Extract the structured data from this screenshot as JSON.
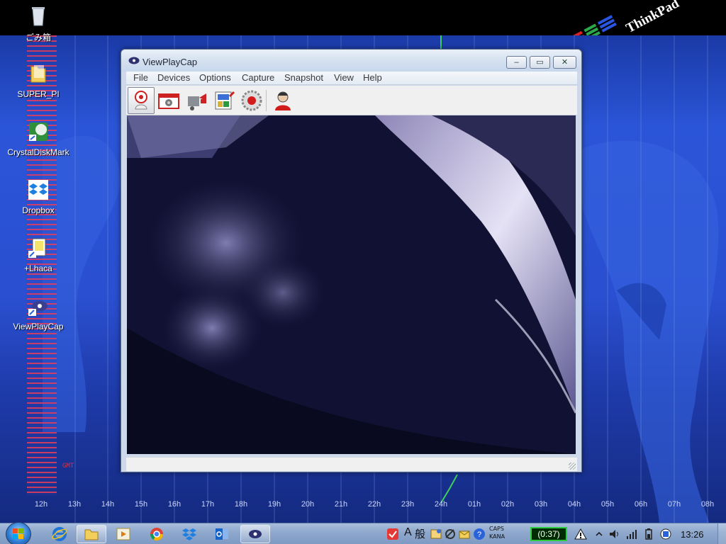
{
  "desktop": {
    "icons": [
      {
        "label": "ごみ箱",
        "icon": "recycle-bin-icon"
      },
      {
        "label": "SUPER_PI",
        "icon": "folder-icon"
      },
      {
        "label": "CrystalDiskMark",
        "icon": "crystaldiskmark-icon"
      },
      {
        "label": "Dropbox",
        "icon": "dropbox-icon"
      },
      {
        "label": "+Lhaca",
        "icon": "lhaca-icon"
      },
      {
        "label": "ViewPlayCap",
        "icon": "viewplaycap-icon"
      }
    ],
    "wallpaper": {
      "brand": "ThinkPad",
      "gmt_label": "GMT",
      "hours": [
        "12h",
        "13h",
        "14h",
        "15h",
        "16h",
        "17h",
        "18h",
        "19h",
        "20h",
        "21h",
        "22h",
        "23h",
        "24h",
        "01h",
        "02h",
        "03h",
        "04h",
        "05h",
        "06h",
        "07h",
        "08h"
      ]
    }
  },
  "window": {
    "title": "ViewPlayCap",
    "controls": {
      "minimize": "‒",
      "maximize": "▭",
      "close": "✕"
    },
    "menu": [
      "File",
      "Devices",
      "Options",
      "Capture",
      "Snapshot",
      "View",
      "Help"
    ],
    "toolbar": [
      {
        "icon": "webcam-preview-icon",
        "active": true
      },
      {
        "icon": "camera-snapshot-icon",
        "active": false
      },
      {
        "icon": "video-capture-icon",
        "active": false
      },
      {
        "icon": "properties-icon",
        "active": false
      },
      {
        "icon": "record-icon",
        "active": false
      },
      {
        "icon": "user-icon",
        "active": false
      }
    ],
    "status_text": ""
  },
  "taskbar": {
    "pinned": [
      {
        "icon": "internet-explorer-icon",
        "running": false
      },
      {
        "icon": "windows-explorer-icon",
        "running": true
      },
      {
        "icon": "media-player-icon",
        "running": false
      },
      {
        "icon": "chrome-icon",
        "running": false
      },
      {
        "icon": "dropbox-icon",
        "running": false
      },
      {
        "icon": "outlook-icon",
        "running": false
      },
      {
        "icon": "viewplaycap-icon",
        "running": true
      }
    ],
    "ime": {
      "mode": "A",
      "kanji": "般"
    },
    "caps": "CAPS",
    "kana": "KANA",
    "timer": "(0:37)",
    "clock": "13:26"
  },
  "colors": {
    "accent": "#2b55d8",
    "timer_border": "#2ecc40"
  }
}
